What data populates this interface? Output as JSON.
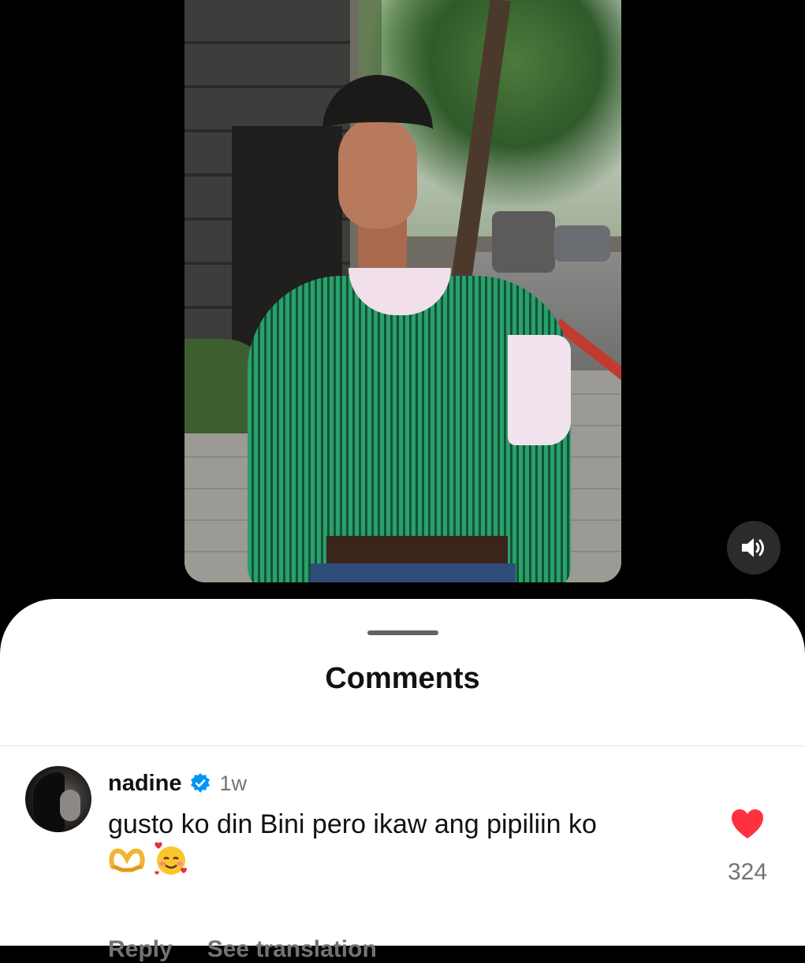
{
  "video": {
    "sound_icon": "speaker-icon"
  },
  "comments_sheet": {
    "title": "Comments",
    "comment": {
      "username": "nadine",
      "verified_icon": "verified-badge-icon",
      "time": "1w",
      "text": "gusto ko din Bini pero ikaw ang pipiliin ko",
      "emojis": [
        "🫶",
        "🥰"
      ],
      "reply_label": "Reply",
      "translate_label": "See translation",
      "like_icon": "heart-icon",
      "like_color": "#ff3040",
      "like_count": "324"
    }
  }
}
